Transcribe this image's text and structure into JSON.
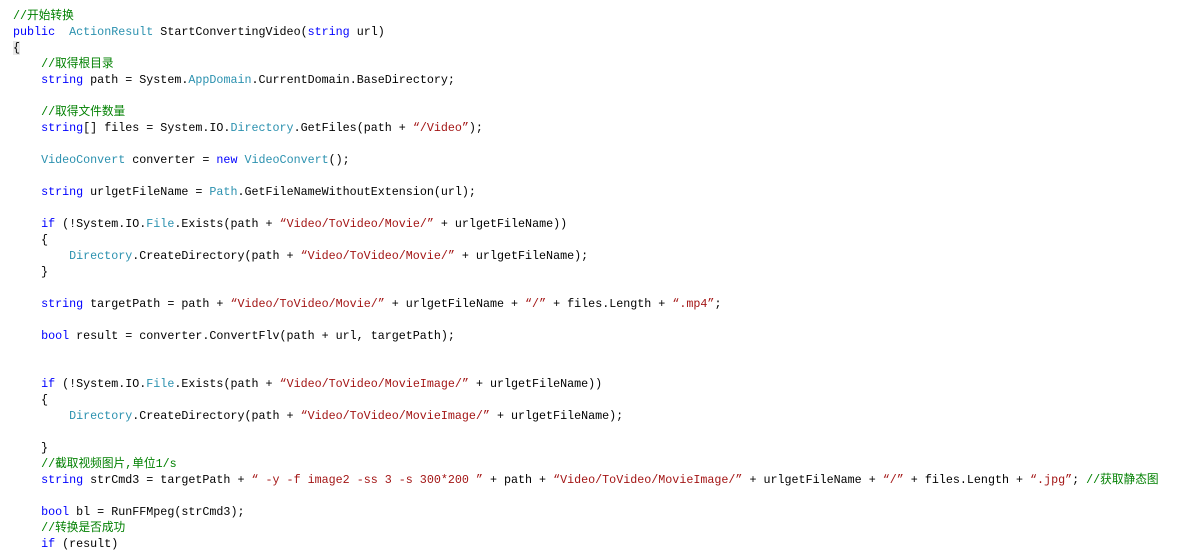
{
  "colors": {
    "kw": "#0000ff",
    "type": "#2b91af",
    "str": "#a31515",
    "cm": "#008000",
    "plain": "#000000"
  },
  "code_lines": [
    [
      [
        "cm",
        "//开始转换"
      ]
    ],
    [
      [
        "kw",
        "public"
      ],
      [
        "",
        "  "
      ],
      [
        "type",
        "ActionResult"
      ],
      [
        "",
        " StartConvertingVideo("
      ],
      [
        "kw",
        "string"
      ],
      [
        "",
        " url)"
      ]
    ],
    [
      [
        "brace-hl",
        "{"
      ]
    ],
    [
      [
        "",
        "    "
      ],
      [
        "cm",
        "//取得根目录"
      ]
    ],
    [
      [
        "",
        "    "
      ],
      [
        "kw",
        "string"
      ],
      [
        "",
        " path = System."
      ],
      [
        "type",
        "AppDomain"
      ],
      [
        "",
        ".CurrentDomain.BaseDirectory;"
      ]
    ],
    [],
    [
      [
        "",
        "    "
      ],
      [
        "cm",
        "//取得文件数量"
      ]
    ],
    [
      [
        "",
        "    "
      ],
      [
        "kw",
        "string"
      ],
      [
        "",
        "[] files = System.IO."
      ],
      [
        "type",
        "Directory"
      ],
      [
        "",
        ".GetFiles(path + "
      ],
      [
        "str",
        "“/Video”"
      ],
      [
        "",
        ");"
      ]
    ],
    [],
    [
      [
        "",
        "    "
      ],
      [
        "type",
        "VideoConvert"
      ],
      [
        "",
        " converter = "
      ],
      [
        "kw",
        "new"
      ],
      [
        "",
        " "
      ],
      [
        "type",
        "VideoConvert"
      ],
      [
        "",
        "();"
      ]
    ],
    [],
    [
      [
        "",
        "    "
      ],
      [
        "kw",
        "string"
      ],
      [
        "",
        " urlgetFileName = "
      ],
      [
        "type",
        "Path"
      ],
      [
        "",
        ".GetFileNameWithoutExtension(url);"
      ]
    ],
    [],
    [
      [
        "",
        "    "
      ],
      [
        "kw",
        "if"
      ],
      [
        "",
        " (!System.IO."
      ],
      [
        "type",
        "File"
      ],
      [
        "",
        ".Exists(path + "
      ],
      [
        "str",
        "“Video/ToVideo/Movie/”"
      ],
      [
        "",
        " + urlgetFileName))"
      ]
    ],
    [
      [
        "",
        "    {"
      ]
    ],
    [
      [
        "",
        "        "
      ],
      [
        "type",
        "Directory"
      ],
      [
        "",
        ".CreateDirectory(path + "
      ],
      [
        "str",
        "“Video/ToVideo/Movie/”"
      ],
      [
        "",
        " + urlgetFileName);"
      ]
    ],
    [
      [
        "",
        "    }"
      ]
    ],
    [],
    [
      [
        "",
        "    "
      ],
      [
        "kw",
        "string"
      ],
      [
        "",
        " targetPath = path + "
      ],
      [
        "str",
        "“Video/ToVideo/Movie/”"
      ],
      [
        "",
        " + urlgetFileName + "
      ],
      [
        "str",
        "“/”"
      ],
      [
        "",
        " + files.Length + "
      ],
      [
        "str",
        "“.mp4”"
      ],
      [
        "",
        ";"
      ]
    ],
    [],
    [
      [
        "",
        "    "
      ],
      [
        "kw",
        "bool"
      ],
      [
        "",
        " result = converter.ConvertFlv(path + url, targetPath);"
      ]
    ],
    [],
    [],
    [
      [
        "",
        "    "
      ],
      [
        "kw",
        "if"
      ],
      [
        "",
        " (!System.IO."
      ],
      [
        "type",
        "File"
      ],
      [
        "",
        ".Exists(path + "
      ],
      [
        "str",
        "“Video/ToVideo/MovieImage/”"
      ],
      [
        "",
        " + urlgetFileName))"
      ]
    ],
    [
      [
        "",
        "    {"
      ]
    ],
    [
      [
        "",
        "        "
      ],
      [
        "type",
        "Directory"
      ],
      [
        "",
        ".CreateDirectory(path + "
      ],
      [
        "str",
        "“Video/ToVideo/MovieImage/”"
      ],
      [
        "",
        " + urlgetFileName);"
      ]
    ],
    [],
    [
      [
        "",
        "    }"
      ]
    ],
    [
      [
        "",
        "    "
      ],
      [
        "cm",
        "//截取视频图片,单位1/s"
      ]
    ],
    [
      [
        "",
        "    "
      ],
      [
        "kw",
        "string"
      ],
      [
        "",
        " strCmd3 = targetPath + "
      ],
      [
        "str",
        "“ -y -f image2 -ss 3 -s 300*200 ”"
      ],
      [
        "",
        " + path + "
      ],
      [
        "str",
        "“Video/ToVideo/MovieImage/”"
      ],
      [
        "",
        " + urlgetFileName + "
      ],
      [
        "str",
        "“/”"
      ],
      [
        "",
        " + files.Length + "
      ],
      [
        "str",
        "“.jpg”"
      ],
      [
        "",
        "; "
      ],
      [
        "cm",
        "//获取静态图"
      ]
    ],
    [],
    [
      [
        "",
        "    "
      ],
      [
        "kw",
        "bool"
      ],
      [
        "",
        " bl = RunFFMpeg(strCmd3);"
      ]
    ],
    [
      [
        "",
        "    "
      ],
      [
        "cm",
        "//转换是否成功"
      ]
    ],
    [
      [
        "",
        "    "
      ],
      [
        "kw",
        "if"
      ],
      [
        "",
        " (result)"
      ]
    ]
  ]
}
